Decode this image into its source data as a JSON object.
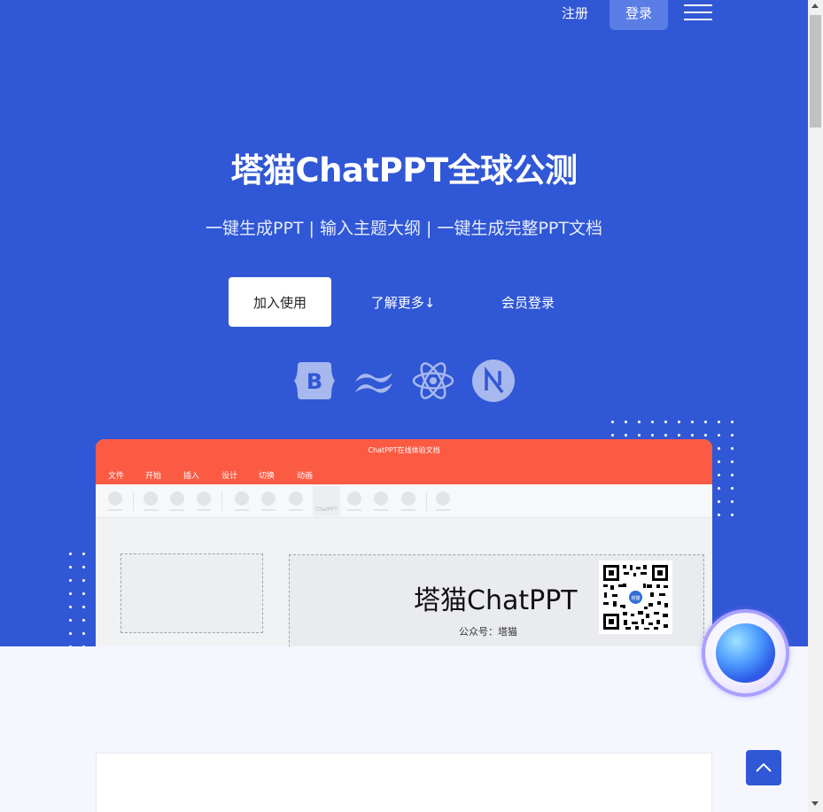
{
  "nav": {
    "register_label": "注册",
    "login_label": "登录",
    "menu_icon": "hamburger-icon"
  },
  "hero": {
    "title": "塔猫ChatPPT全球公测",
    "subtitle": "一键生成PPT | 输入主题大纲 | 一键生成完整PPT文档",
    "buttons": {
      "join": "加入使用",
      "learn_more": "了解更多↓",
      "member_login": "会员登录"
    },
    "tech_icons": [
      "bootstrap-icon",
      "tailwind-icon",
      "react-icon",
      "nextjs-icon"
    ]
  },
  "mock_window": {
    "title": "ChatPPT在线体验文档",
    "menu": [
      "文件",
      "开始",
      "插入",
      "设计",
      "切换",
      "动画"
    ],
    "toolbar_active_label": "ChatPPT",
    "slide": {
      "heading": "塔猫ChatPPT",
      "caption": "公众号：塔猫",
      "qr_badge": "塔猫"
    }
  },
  "colors": {
    "hero_bg": "#3057d5",
    "mock_bar": "#fb5a43",
    "page_bg": "#f5f6fe"
  }
}
